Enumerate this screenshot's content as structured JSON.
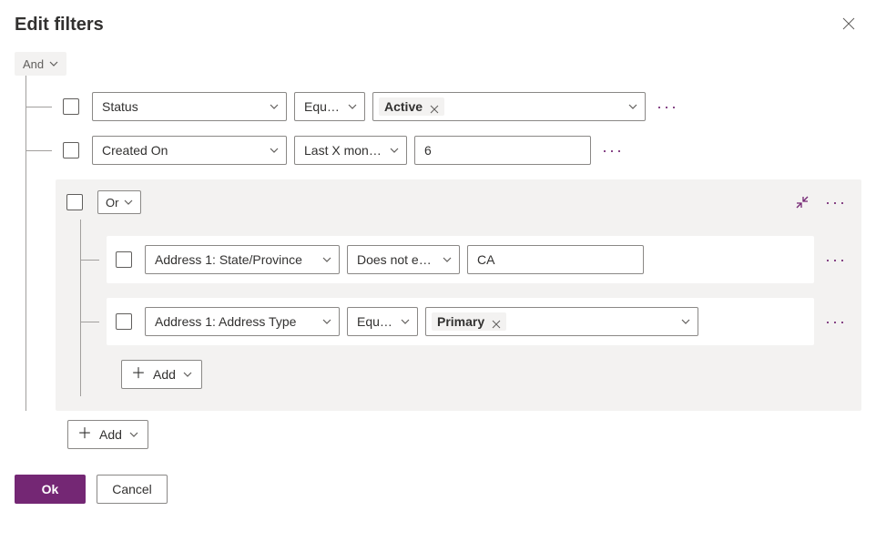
{
  "header": {
    "title": "Edit filters"
  },
  "root": {
    "operator": "And"
  },
  "rows": [
    {
      "field": "Status",
      "operator": "Equals",
      "value_tag": "Active"
    },
    {
      "field": "Created On",
      "operator": "Last X months",
      "value_text": "6"
    }
  ],
  "group": {
    "operator": "Or",
    "rows": [
      {
        "field": "Address 1: State/Province",
        "operator": "Does not equal",
        "value_text": "CA"
      },
      {
        "field": "Address 1: Address Type",
        "operator": "Equals",
        "value_tag": "Primary"
      }
    ],
    "add_label": "Add"
  },
  "root_add_label": "Add",
  "buttons": {
    "ok": "Ok",
    "cancel": "Cancel"
  }
}
